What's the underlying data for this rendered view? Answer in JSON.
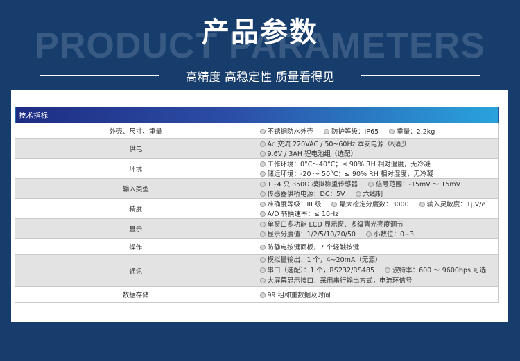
{
  "header": {
    "title": "产品参数",
    "bg_text": "PRODUCT PARAMETERS",
    "subtitle": "高精度 高稳定性 质量看得见"
  },
  "table": {
    "header": "技术指标",
    "rows": [
      {
        "label": "外壳、尺寸、重量",
        "items": [
          "不锈钢防水外壳",
          "防护等级：IP65",
          "重量：2.2kg"
        ]
      },
      {
        "label": "供电",
        "items": [
          "Ac 交流 220VAC / 50~60Hz 本安电源（标配）",
          "9.6V / 3AH 锂电池组（选配）"
        ]
      },
      {
        "label": "环境",
        "items": [
          "工作环境：0°C～40°C；≤ 90% RH 相对湿度，无冷凝",
          "储运环境：-20 ～ 50°C；≤ 90% RH 相对湿度，无冷凝"
        ]
      },
      {
        "label": "输入类型",
        "items": [
          "1~4 只 350Ω 模拟称重传感器",
          "信号范围：-15mV ～ 15mV",
          "传感器供桥电源：DC：5V",
          "六线制"
        ]
      },
      {
        "label": "精度",
        "items": [
          "准确度等级：III 级",
          "最大检定分度数：3000",
          "输入灵敏度：1μV/e",
          "A/D 转换速率：≤ 10Hz"
        ]
      },
      {
        "label": "显示",
        "items": [
          "单窗口多功能 LCD 显示窗、多级背光亮度调节",
          "显示分度值：1/2/5/10/20/50",
          "小数位：0~3"
        ]
      },
      {
        "label": "操作",
        "items": [
          "防静电按键面板，7 个轻触按键"
        ]
      },
      {
        "label": "通讯",
        "line1": [
          "模拟量输出：1 个，4~20mA（无源）",
          "串口（选配）：1 个，RS232/RS485",
          "波特率：600 ～ 9600bps 可选"
        ],
        "line2": [
          "大屏幕显示接口：采用串行输出方式，电流环信号"
        ]
      },
      {
        "label": "数据存储",
        "items": [
          "99 组称重数据及时间"
        ]
      }
    ]
  }
}
